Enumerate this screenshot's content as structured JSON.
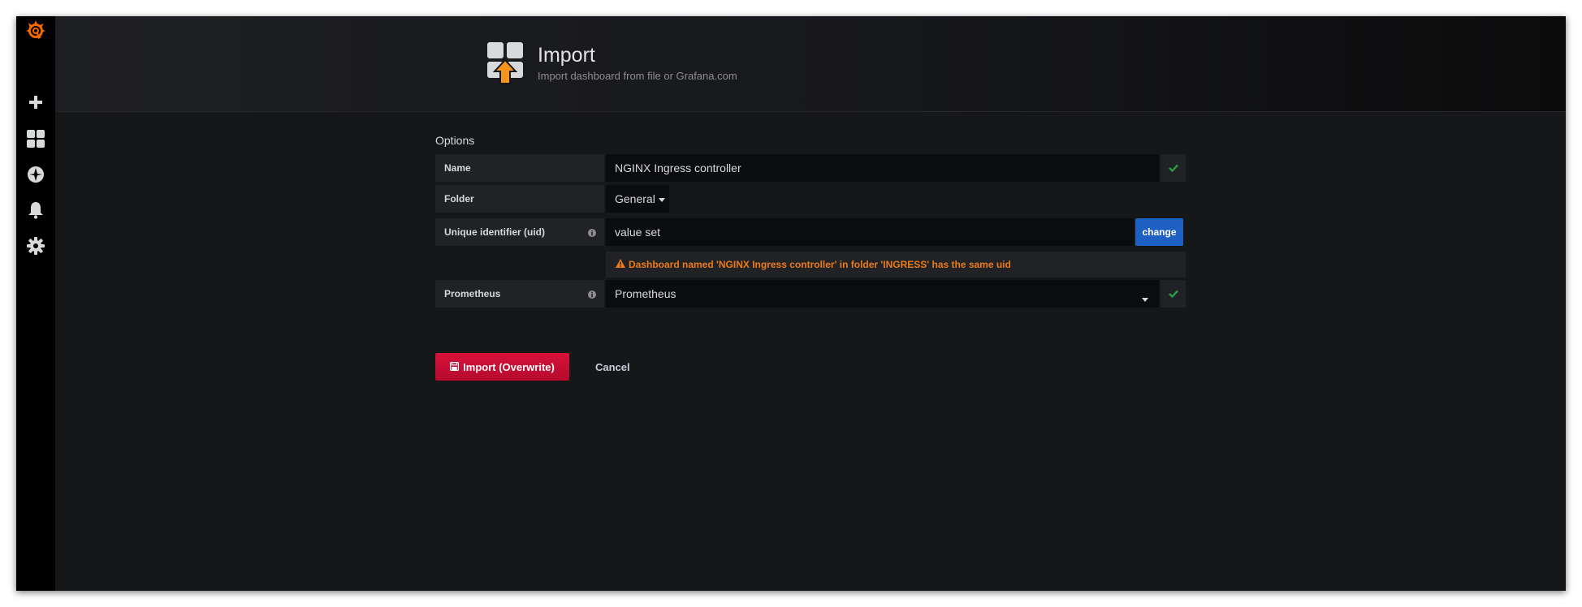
{
  "header": {
    "title": "Import",
    "subtitle": "Import dashboard from file or Grafana.com"
  },
  "sidemenu": {
    "items": [
      "grafana-logo-icon",
      "plus-icon",
      "dashboards-icon",
      "explore-icon",
      "alerting-bell-icon",
      "configuration-gear-icon"
    ]
  },
  "options": {
    "title": "Options",
    "name_label": "Name",
    "name_value": "NGINX Ingress controller",
    "folder_label": "Folder",
    "folder_value": "General",
    "uid_label": "Unique identifier (uid)",
    "uid_value": "value set",
    "change_label": "change",
    "uid_warning": "Dashboard named 'NGINX Ingress controller' in folder 'INGRESS' has the same uid",
    "prometheus_label": "Prometheus",
    "prometheus_value": "Prometheus"
  },
  "actions": {
    "import_label": "Import (Overwrite)",
    "cancel_label": "Cancel"
  },
  "colors": {
    "background": "#161719",
    "sidemenu": "#000000",
    "label_bg": "#202226",
    "input_bg": "#0b0c0e",
    "primary_blue": "#1f60c4",
    "danger_red": "#d8123a",
    "warning_orange": "#eb7b18",
    "success_green": "#299c46",
    "logo_orange": "#f46800"
  }
}
